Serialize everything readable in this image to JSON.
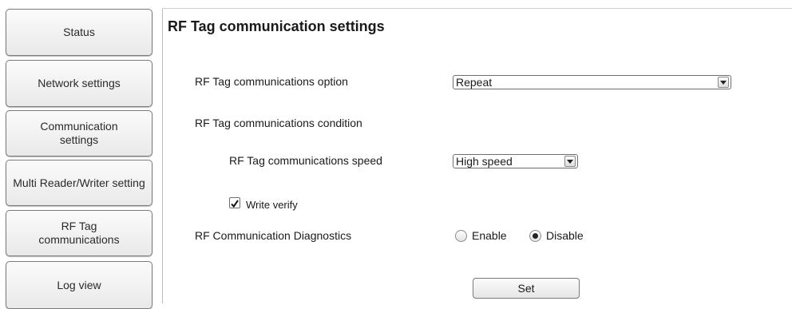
{
  "sidebar": {
    "items": [
      {
        "label": "Status"
      },
      {
        "label": "Network settings"
      },
      {
        "label": "Communication settings"
      },
      {
        "label": "Multi Reader/Writer setting"
      },
      {
        "label": "RF Tag communications"
      },
      {
        "label": "Log view"
      }
    ]
  },
  "main": {
    "title": "RF Tag communication settings",
    "option": {
      "label": "RF Tag communications option",
      "value": "Repeat"
    },
    "condition": {
      "label": "RF Tag communications condition"
    },
    "speed": {
      "label": "RF Tag communications speed",
      "value": "High speed"
    },
    "verify": {
      "label": "Write verify",
      "checked": true
    },
    "diagnostics": {
      "label": "RF Communication Diagnostics",
      "enable_label": "Enable",
      "disable_label": "Disable",
      "selected": "Disable"
    },
    "set_label": "Set"
  }
}
